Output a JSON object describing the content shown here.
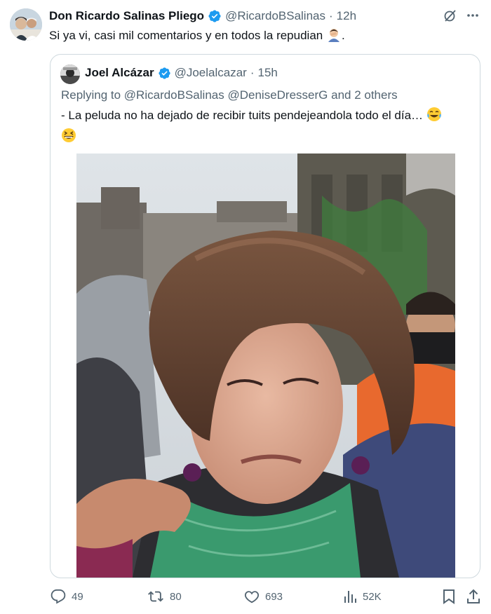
{
  "tweet": {
    "author_name": "Don Ricardo Salinas Pliego",
    "author_handle": "@RicardoBSalinas",
    "separator": "·",
    "time": "12h",
    "text": "Si ya vi, casi mil comentarios y en todos la repudian",
    "text_end": "."
  },
  "quote": {
    "author_name": "Joel Alcázar",
    "author_handle": "@Joelalcazar",
    "separator": "·",
    "time": "15h",
    "replying_prefix": "Replying to",
    "replying_user1": "@RicardoBSalinas",
    "replying_user2": "@DeniseDresserG",
    "replying_suffix": "and 2 others",
    "text": "- La peluda no ha dejado de recibir tuits pendejeandola todo el día…"
  },
  "actions": {
    "replies": "49",
    "retweets": "80",
    "likes": "693",
    "views": "52K"
  },
  "colors": {
    "verified": "#1d9bf0",
    "secondary_text": "#536471",
    "border": "#cfd9de"
  },
  "icons": [
    "verified-badge-icon",
    "grok-icon",
    "more-icon",
    "facepalm-emoji",
    "laughing-tears-emoji",
    "grinning-squint-emoji",
    "reply-icon",
    "retweet-icon",
    "like-icon",
    "views-icon",
    "bookmark-icon",
    "share-icon"
  ]
}
